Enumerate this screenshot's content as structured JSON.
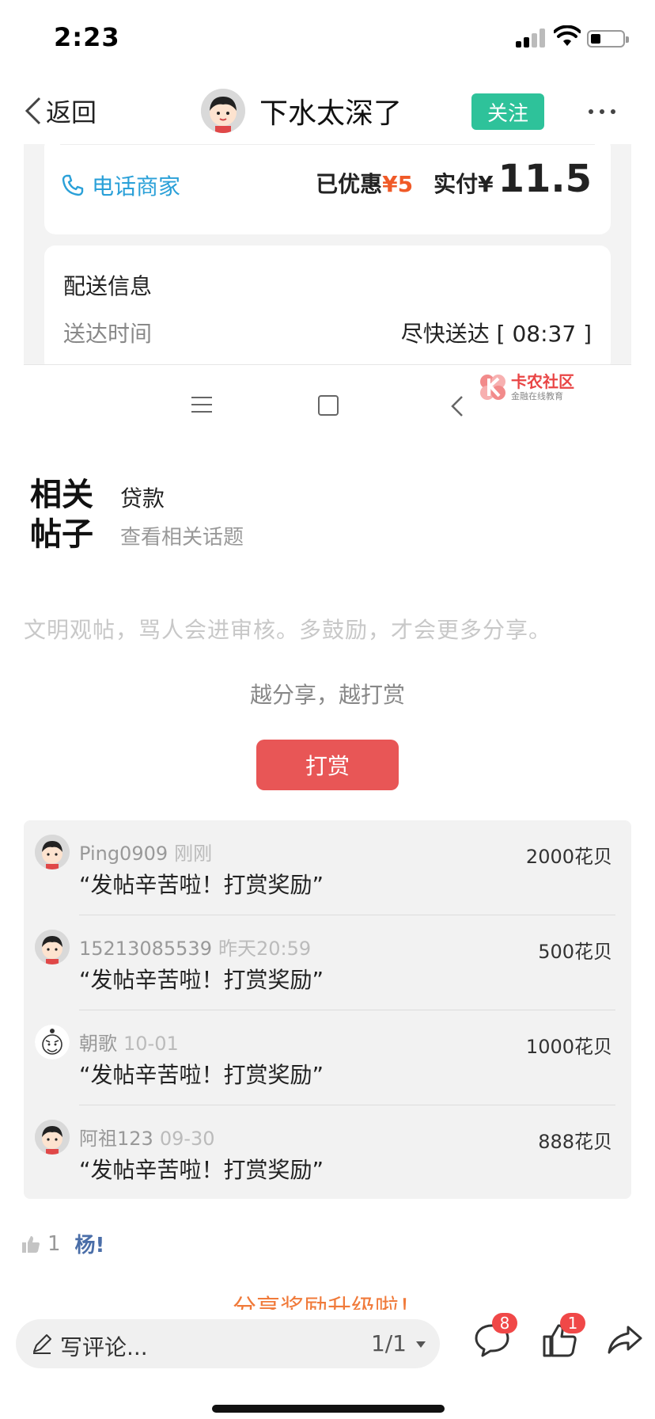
{
  "status_bar": {
    "time": "2:23"
  },
  "nav": {
    "back_label": "返回",
    "title": "下水太深了",
    "follow_label": "关注"
  },
  "embedded_screenshot": {
    "call_merchant": "电话商家",
    "discount_label": "已优惠",
    "discount_value": "¥5",
    "paid_label": "实付¥",
    "paid_value": "11.5",
    "delivery_title": "配送信息",
    "delivery_time_label": "送达时间",
    "delivery_time_value": "尽快送达 [ 08:37 ]",
    "watermark_title": "卡农社区",
    "watermark_subtitle": "金融在线教育"
  },
  "related": {
    "tag": "相关帖子",
    "topic": "贷款",
    "link": "查看相关话题"
  },
  "notice": "文明观帖，骂人会进审核。多鼓励，才会更多分享。",
  "reward": {
    "slogan": "越分享，越打赏",
    "button_label": "打赏",
    "items": [
      {
        "user": "Ping0909",
        "time": "刚刚",
        "message": "“发帖辛苦啦！打赏奖励”",
        "amount": "2000花贝",
        "avatar": "boy-avatar"
      },
      {
        "user": "15213085539",
        "time": "昨天20:59",
        "message": "“发帖辛苦啦！打赏奖励”",
        "amount": "500花贝",
        "avatar": "boy-avatar"
      },
      {
        "user": "朝歌",
        "time": "10-01",
        "message": "“发帖辛苦啦！打赏奖励”",
        "amount": "1000花贝",
        "avatar": "sketch-avatar"
      },
      {
        "user": "阿祖123",
        "time": "09-30",
        "message": "“发帖辛苦啦！打赏奖励”",
        "amount": "888花贝",
        "avatar": "boy-avatar"
      }
    ]
  },
  "likes": {
    "count": "1",
    "user": "杨!"
  },
  "cutoff_text": "分享奖励升级啦！",
  "bottom_bar": {
    "comment_placeholder": "写评论...",
    "page_indicator": "1/1",
    "comment_badge": "8",
    "like_badge": "1"
  },
  "colors": {
    "follow_green": "#2ec29a",
    "reward_red": "#e85656",
    "badge_red": "#f04848",
    "link_blue": "#2aa0d8",
    "discount_orange": "#f05a28"
  }
}
